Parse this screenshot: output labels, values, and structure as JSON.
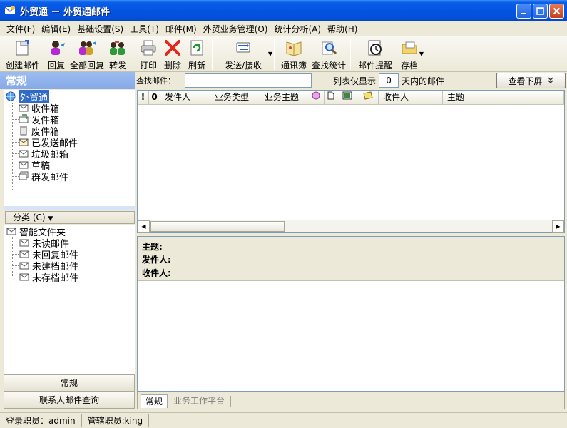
{
  "window": {
    "title": "外贸通 － 外贸通邮件"
  },
  "menu": [
    "文件(F)",
    "编辑(E)",
    "基础设置(S)",
    "工具(T)",
    "邮件(M)",
    "外贸业务管理(O)",
    "统计分析(A)",
    "帮助(H)"
  ],
  "toolbar": {
    "create_mail": "创建邮件",
    "reply": "回复",
    "reply_all": "全部回复",
    "forward": "转发",
    "print": "打印",
    "delete": "删除",
    "refresh": "刷新",
    "send_receive": "发送/接收",
    "address_book": "通讯簿",
    "search_stats": "查找统计",
    "mail_reminder": "邮件提醒",
    "archive": "存档"
  },
  "left_header": "常规",
  "search": {
    "label": "查找邮件：",
    "value": ""
  },
  "list_filter": {
    "prefix": "列表仅显示",
    "days": "0",
    "suffix": "天内的邮件"
  },
  "view_button": "查看下屏",
  "tree": {
    "root": "外贸通",
    "items": [
      "收件箱",
      "发件箱",
      "废件箱",
      "已发送邮件",
      "垃圾邮箱",
      "草稿",
      "群发邮件"
    ]
  },
  "category": {
    "label": "分类 (C)"
  },
  "smart": {
    "root": "智能文件夹",
    "items": [
      "未读邮件",
      "未回复邮件",
      "未建档邮件",
      "未存档邮件"
    ]
  },
  "left_tabs": {
    "general": "常规",
    "contact_query": "联系人邮件查询"
  },
  "columns": {
    "priority": "!",
    "attachment": "0",
    "sender": "发件人",
    "biz_type": "业务类型",
    "biz_subject": "业务主题",
    "recipient": "收件人",
    "subject": "主题"
  },
  "preview": {
    "subject": "主题:",
    "from": "发件人:",
    "to": "收件人:"
  },
  "bottom_tabs": {
    "general": "常规",
    "workbench": "业务工作平台"
  },
  "status": {
    "login": "登录职员：admin",
    "manager": "管辖职员:king"
  }
}
